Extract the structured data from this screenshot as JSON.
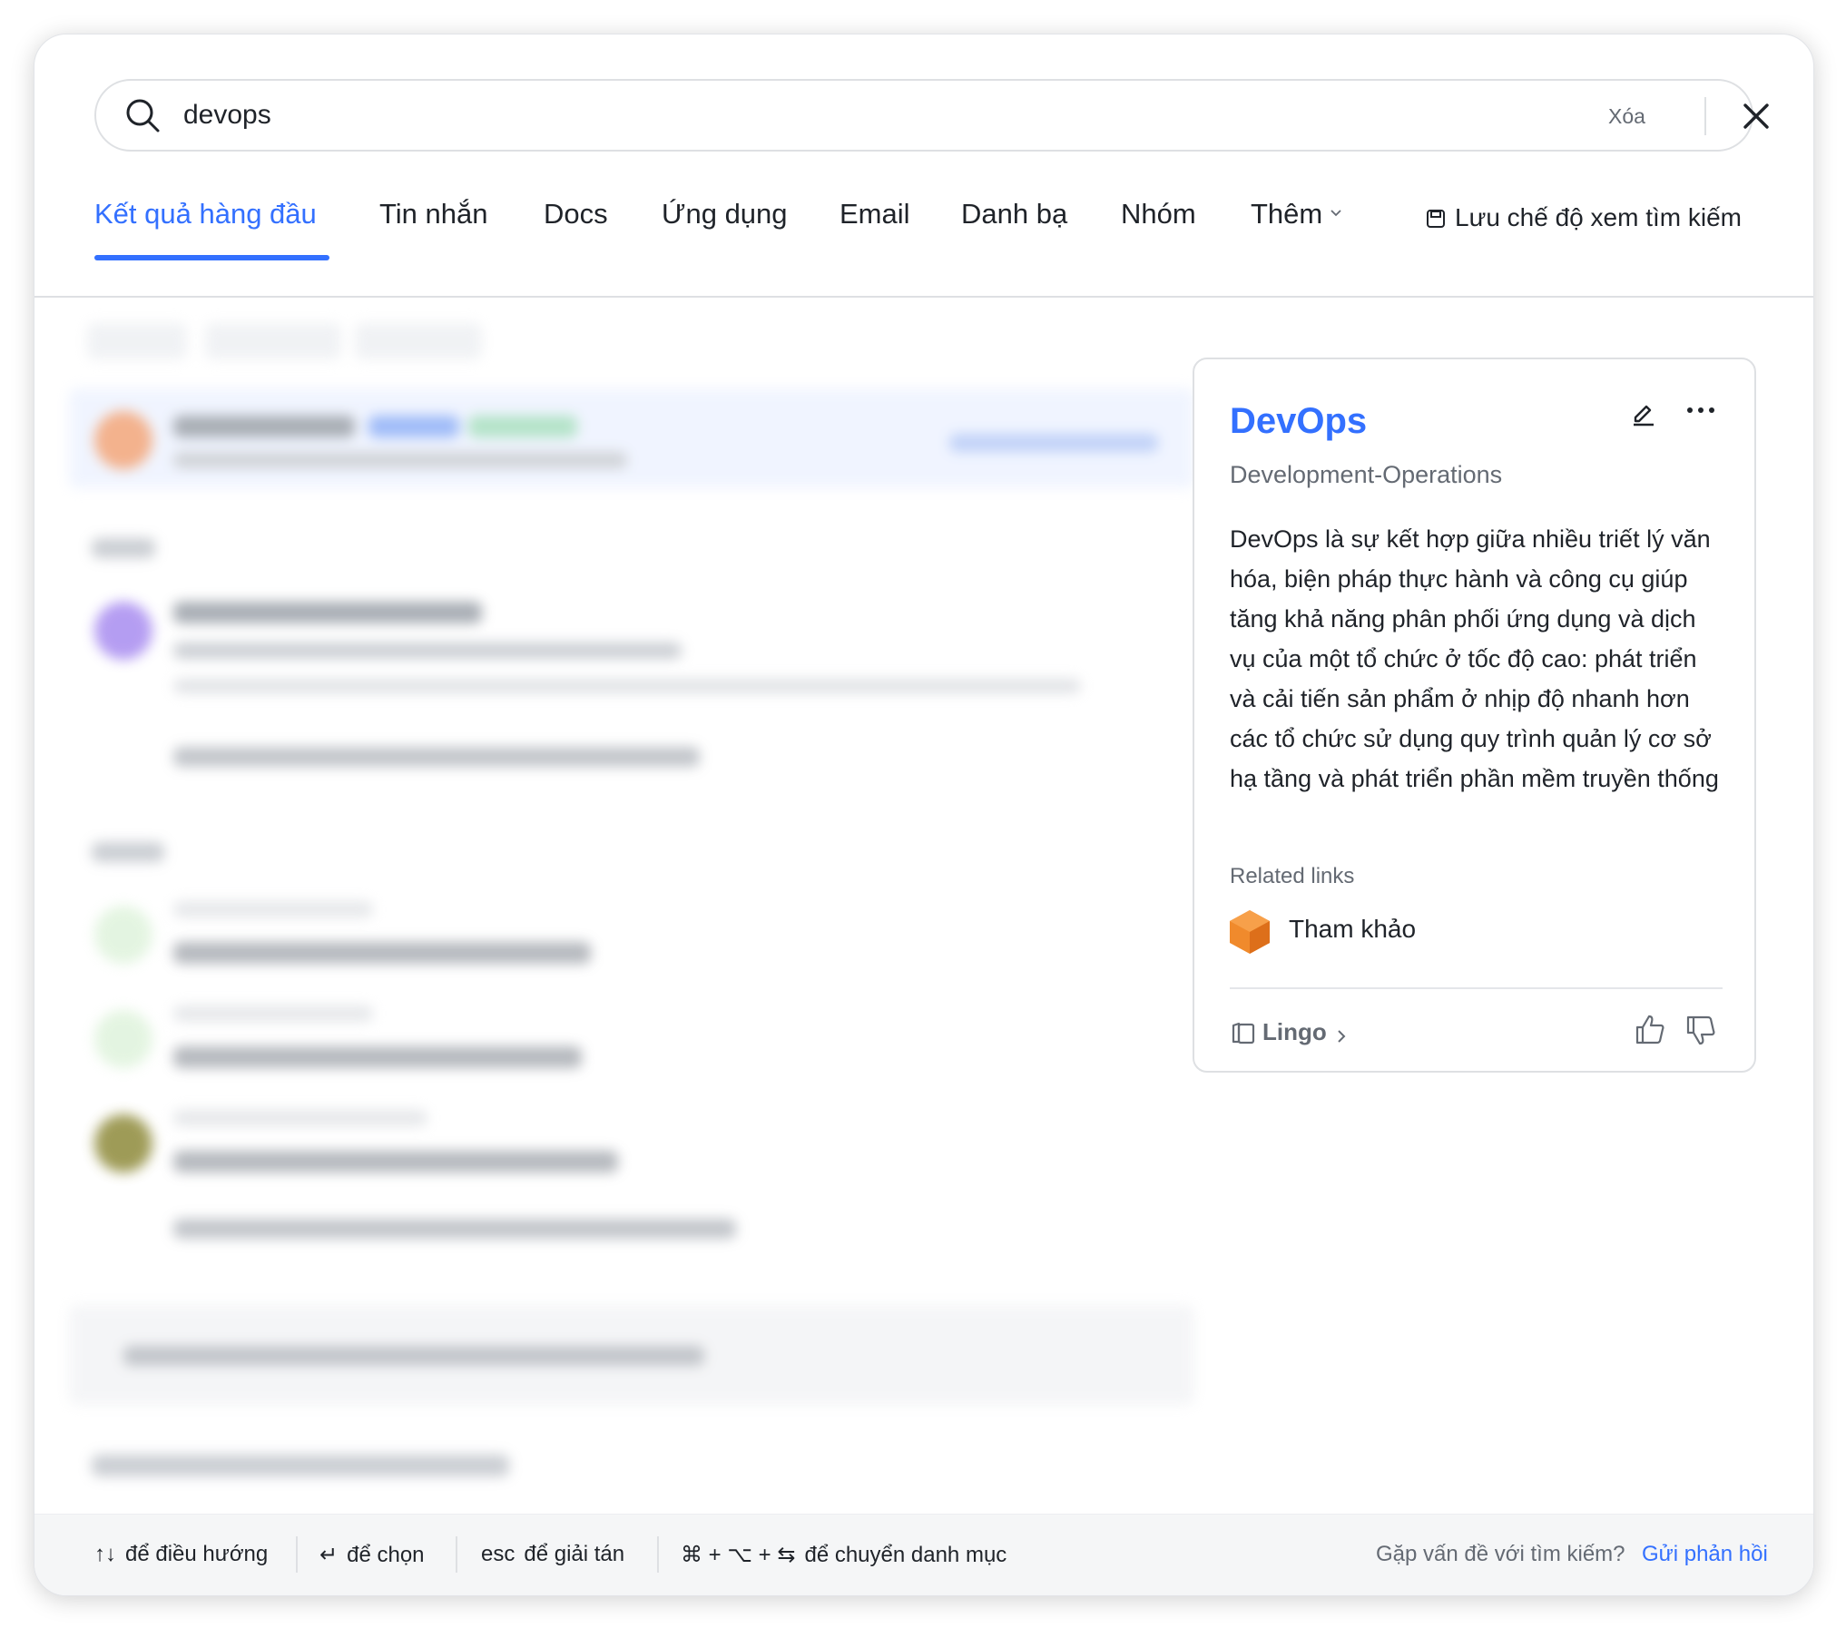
{
  "search": {
    "query": "devops",
    "clear_label": "Xóa"
  },
  "tabs": [
    {
      "label": "Kết quả hàng đầu",
      "active": true
    },
    {
      "label": "Tin nhắn"
    },
    {
      "label": "Docs"
    },
    {
      "label": "Ứng dụng"
    },
    {
      "label": "Email"
    },
    {
      "label": "Danh bạ"
    },
    {
      "label": "Nhóm"
    },
    {
      "label": "Thêm"
    }
  ],
  "save_view_label": "Lưu chế độ xem tìm kiếm",
  "card": {
    "title": "DevOps",
    "subtitle": "Development-Operations",
    "description": "DevOps là sự kết hợp giữa nhiều triết lý văn hóa, biện pháp thực hành và công cụ giúp tăng khả năng phân phối ứng dụng và dịch vụ của một tổ chức ở tốc độ cao: phát triển và cải tiến sản phẩm ở nhịp độ nhanh hơn các tổ chức sử dụng quy trình quản lý cơ sở hạ tầng và phát triển phần mềm truyền thống",
    "related_title": "Related links",
    "related_links": [
      {
        "label": "Tham khảo",
        "icon": "orange-cube-icon"
      }
    ],
    "source": "Lingo"
  },
  "footer": {
    "navigate_keys": "↑↓",
    "navigate_label": "để điều hướng",
    "select_key": "↵",
    "select_label": "để chọn",
    "dismiss_key": "esc",
    "dismiss_label": "để giải tán",
    "switch_keys": "⌘ + ⌥ + ⇆",
    "switch_label": "để chuyển danh mục",
    "feedback_question": "Gặp vấn đề với tìm kiếm?",
    "feedback_link": "Gửi phản hồi"
  },
  "colors": {
    "accent": "#3370ff",
    "text": "#1f2329",
    "muted": "#646a73",
    "border": "#dee0e3"
  }
}
